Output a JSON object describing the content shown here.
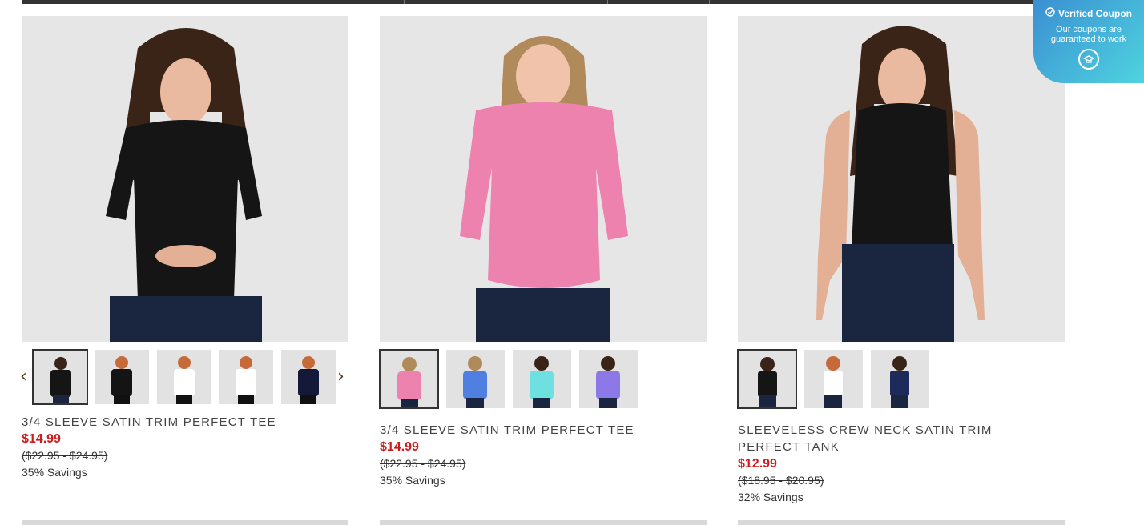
{
  "coupon": {
    "title": "Verified Coupon",
    "line1": "Our coupons are",
    "line2": "guaranteed to work",
    "check_icon": "check-circle-icon",
    "logo_icon": "hat-logo-icon"
  },
  "nav": {
    "prev_icon": "‹",
    "next_icon": "›"
  },
  "products": [
    {
      "title": "3/4 SLEEVE SATIN TRIM PERFECT TEE",
      "price": "$14.99",
      "original": "($22.95 - $24.95)",
      "savings": "35% Savings",
      "shirt_color": "#151515",
      "thumb_colors": [
        "#151515",
        "#141414",
        "#ffffff",
        "#ffffff",
        "#14193a"
      ]
    },
    {
      "title": "3/4 SLEEVE SATIN TRIM PERFECT TEE",
      "price": "$14.99",
      "original": "($22.95 - $24.95)",
      "savings": "35% Savings",
      "shirt_color": "#ee82ae",
      "thumb_colors": [
        "#ee82ae",
        "#4f7fe0",
        "#6fe0e0",
        "#8c78e6"
      ]
    },
    {
      "title_line1": "SLEEVELESS CREW NECK SATIN TRIM",
      "title_line2": "PERFECT TANK",
      "price": "$12.99",
      "original": "($18.95 - $20.95)",
      "savings": "32% Savings",
      "shirt_color": "#151515",
      "thumb_colors": [
        "#151515",
        "#ffffff",
        "#1e2a5a"
      ]
    }
  ]
}
